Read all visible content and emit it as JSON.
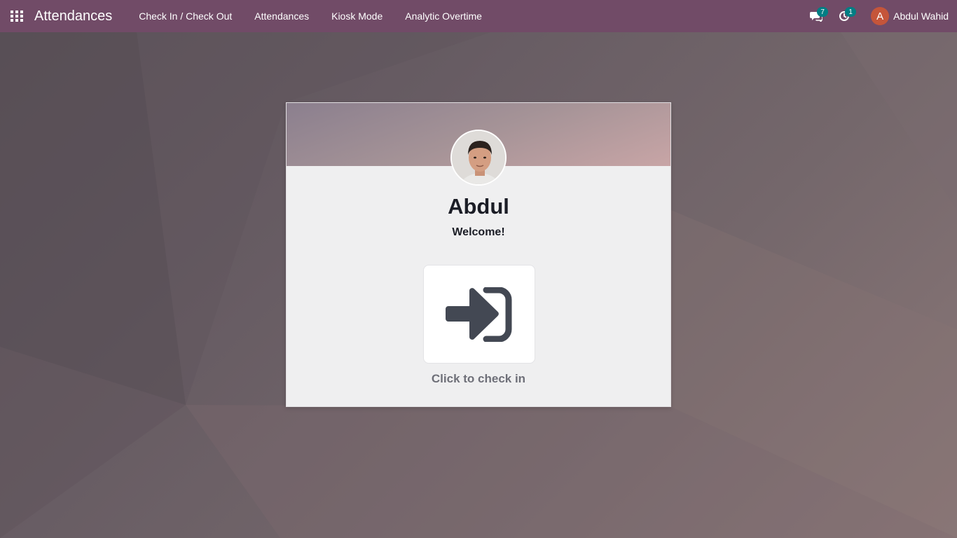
{
  "navbar": {
    "apps_icon": "grid-apps-icon",
    "app_title": "Attendances",
    "menu": [
      {
        "label": "Check In / Check Out"
      },
      {
        "label": "Attendances"
      },
      {
        "label": "Kiosk Mode"
      },
      {
        "label": "Analytic Overtime"
      }
    ],
    "messages": {
      "icon": "chat-icon",
      "count": "7"
    },
    "activities": {
      "icon": "clock-icon",
      "count": "1"
    },
    "user": {
      "initial": "A",
      "name": "Abdul Wahid"
    }
  },
  "card": {
    "photo_icon": "employee-photo",
    "employee_name": "Abdul",
    "welcome": "Welcome!",
    "checkin_icon": "sign-in-icon",
    "caption": "Click to check in"
  },
  "colors": {
    "navbar": "#714b67",
    "badge": "#017e84",
    "avatar": "#c5553a",
    "icon": "#434853"
  }
}
